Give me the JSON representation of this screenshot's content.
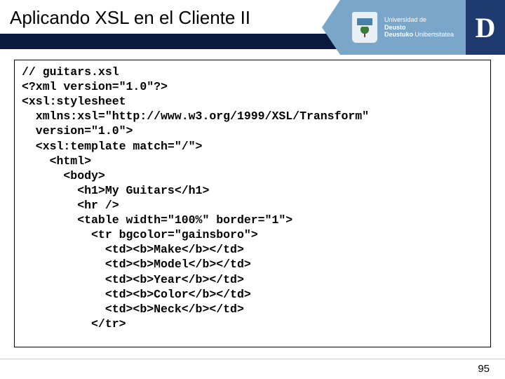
{
  "header": {
    "title": "Aplicando XSL en el Cliente II",
    "logo": {
      "line1": "Universidad de",
      "line2_bold": "Deusto",
      "line3_bold": "Deustuko",
      "line3_rest": " Unibertsitatea",
      "big_letter": "D"
    }
  },
  "code": {
    "lines": [
      "// guitars.xsl",
      "<?xml version=\"1.0\"?>",
      "<xsl:stylesheet",
      "  xmlns:xsl=\"http://www.w3.org/1999/XSL/Transform\"",
      "  version=\"1.0\">",
      "  <xsl:template match=\"/\">",
      "    <html>",
      "      <body>",
      "        <h1>My Guitars</h1>",
      "        <hr />",
      "        <table width=\"100%\" border=\"1\">",
      "          <tr bgcolor=\"gainsboro\">",
      "            <td><b>Make</b></td>",
      "            <td><b>Model</b></td>",
      "            <td><b>Year</b></td>",
      "            <td><b>Color</b></td>",
      "            <td><b>Neck</b></td>",
      "          </tr>"
    ]
  },
  "footer": {
    "page_number": "95"
  }
}
